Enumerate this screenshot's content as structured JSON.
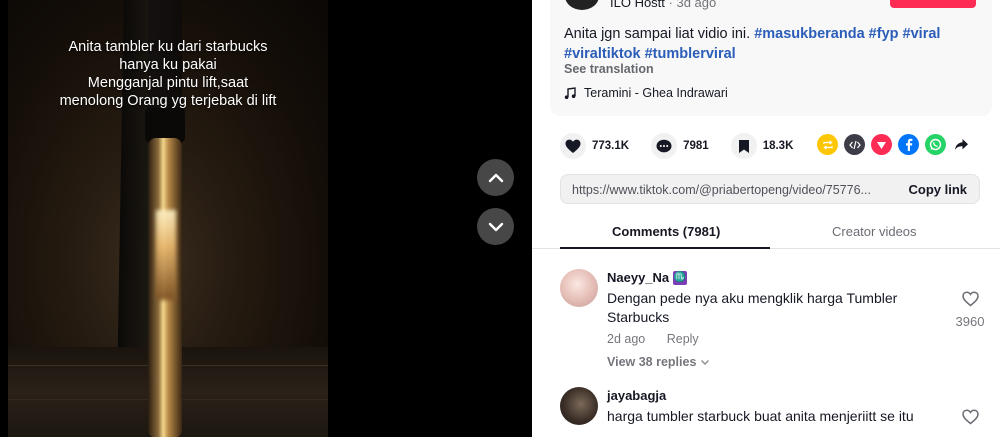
{
  "video": {
    "caption": "Anita tambler ku dari starbucks\nhanya ku pakai\nMengganjal pintu lift,saat\nmenolong Orang yg terjebak di lift"
  },
  "navigation": {
    "up_icon": "chevron-up-icon",
    "down_icon": "chevron-down-icon"
  },
  "author": {
    "name": "ILO Hostt",
    "separator": " · ",
    "time_ago": "3d ago"
  },
  "description": {
    "text": "Anita jgn sampai liat vidio ini. ",
    "hashtags": [
      "#masukberanda",
      "#fyp",
      "#viral",
      "#viraltiktok",
      "#tumblerviral"
    ],
    "see_translation": "See translation",
    "music": "Teramini - Ghea Indrawari"
  },
  "actions": {
    "likes": "773.1K",
    "comments": "7981",
    "saves": "18.3K"
  },
  "share": {
    "icons": [
      "repost-icon",
      "embed-icon",
      "send-icon",
      "facebook-icon",
      "whatsapp-icon",
      "share-arrow-icon"
    ],
    "colors": [
      "#fec704",
      "#161823",
      "#fe2c55",
      "#0075fa",
      "#25d366",
      "#161823"
    ]
  },
  "link": {
    "url": "https://www.tiktok.com/@priabertopeng/video/75776...",
    "copy_label": "Copy link"
  },
  "tabs": {
    "comments": "Comments (7981)",
    "creator": "Creator videos"
  },
  "comments": [
    {
      "username": "Naeyy_Na",
      "badge": "♏",
      "text": "Dengan pede nya aku mengklik harga Tumbler Starbucks",
      "time": "2d ago",
      "reply": "Reply",
      "likes": "3960",
      "view_replies": "View 38 replies"
    },
    {
      "username": "jayabagja",
      "text": "harga tumbler starbuck buat anita menjeriitt se itu"
    }
  ],
  "colors": {
    "accent": "#fe2c55",
    "hashtag": "#2b5db9"
  }
}
